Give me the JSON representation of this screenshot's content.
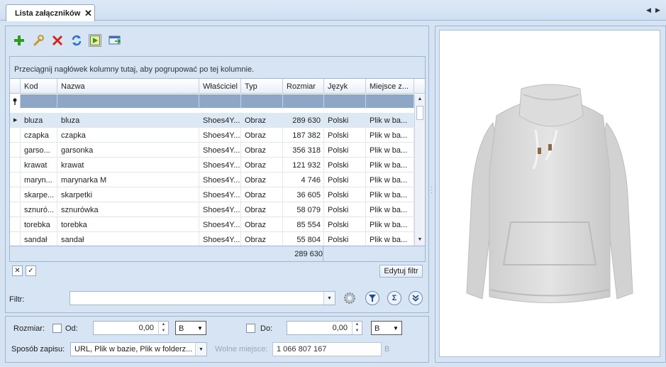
{
  "tab": {
    "title": "Lista załączników",
    "close": "✕"
  },
  "toolbar": {
    "add": "Dodaj",
    "edit": "Edytuj",
    "delete": "Usuń",
    "refresh": "Odśwież",
    "preview": "Podgląd",
    "assign": "Przypisz"
  },
  "grid": {
    "group_hint": "Przeciągnij nagłówek kolumny tutaj, aby pogrupować po tej kolumnie.",
    "columns": [
      "Kod",
      "Nazwa",
      "Właściciel",
      "Typ",
      "Rozmiar",
      "Język",
      "Miejsce z..."
    ],
    "rows": [
      {
        "kod": "bluza",
        "nazwa": "bluza",
        "wlasciciel": "Shoes4Y...",
        "typ": "Obraz",
        "rozmiar": "289 630",
        "jezyk": "Polski",
        "miejsce": "Plik w ba..."
      },
      {
        "kod": "czapka",
        "nazwa": "czapka",
        "wlasciciel": "Shoes4Y...",
        "typ": "Obraz",
        "rozmiar": "187 382",
        "jezyk": "Polski",
        "miejsce": "Plik w ba..."
      },
      {
        "kod": "garso...",
        "nazwa": "garsonka",
        "wlasciciel": "Shoes4Y...",
        "typ": "Obraz",
        "rozmiar": "356 318",
        "jezyk": "Polski",
        "miejsce": "Plik w ba..."
      },
      {
        "kod": "krawat",
        "nazwa": "krawat",
        "wlasciciel": "Shoes4Y...",
        "typ": "Obraz",
        "rozmiar": "121 932",
        "jezyk": "Polski",
        "miejsce": "Plik w ba..."
      },
      {
        "kod": "maryn...",
        "nazwa": "marynarka M",
        "wlasciciel": "Shoes4Y...",
        "typ": "Obraz",
        "rozmiar": "4 746",
        "jezyk": "Polski",
        "miejsce": "Plik w ba..."
      },
      {
        "kod": "skarpe...",
        "nazwa": "skarpetki",
        "wlasciciel": "Shoes4Y...",
        "typ": "Obraz",
        "rozmiar": "36 605",
        "jezyk": "Polski",
        "miejsce": "Plik w ba..."
      },
      {
        "kod": "sznuró...",
        "nazwa": "sznurówka",
        "wlasciciel": "Shoes4Y...",
        "typ": "Obraz",
        "rozmiar": "58 079",
        "jezyk": "Polski",
        "miejsce": "Plik w ba..."
      },
      {
        "kod": "torebka",
        "nazwa": "torebka",
        "wlasciciel": "Shoes4Y...",
        "typ": "Obraz",
        "rozmiar": "85 554",
        "jezyk": "Polski",
        "miejsce": "Plik w ba..."
      },
      {
        "kod": "sandał",
        "nazwa": "sandał",
        "wlasciciel": "Shoes4Y...",
        "typ": "Obraz",
        "rozmiar": "55 804",
        "jezyk": "Polski",
        "miejsce": "Plik w ba..."
      }
    ],
    "footer_sum": "289 630"
  },
  "filter_bar": {
    "edit_filter": "Edytuj filtr",
    "clear": "✕",
    "check": "✓"
  },
  "filter": {
    "label": "Filtr:",
    "value": ""
  },
  "size": {
    "label": "Rozmiar:",
    "from_label": "Od:",
    "from_value": "0,00",
    "from_unit": "B",
    "to_label": "Do:",
    "to_value": "0,00",
    "to_unit": "B"
  },
  "storage": {
    "label": "Sposób zapisu:",
    "value": "URL, Plik w bazie, Plik w folderz...",
    "free_label": "Wolne miejsce:",
    "free_value": "1 066 807 167",
    "free_unit": "B"
  },
  "colors": {
    "accent": "#8fa7c6",
    "panel": "#d6e4f4",
    "selected_row": "#dde8f5"
  }
}
